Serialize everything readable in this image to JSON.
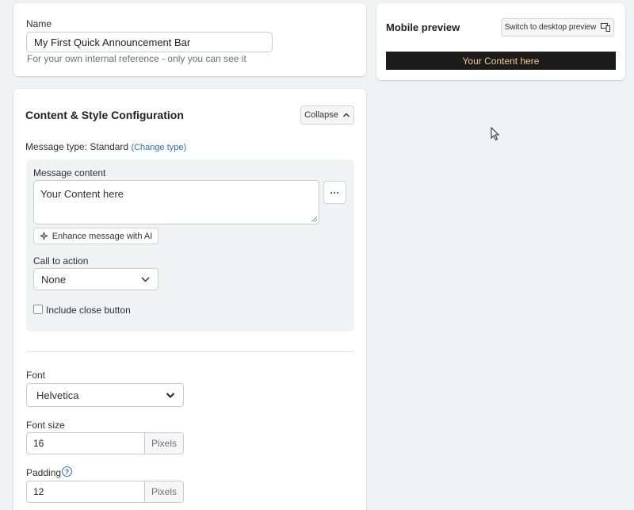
{
  "name_section": {
    "label": "Name",
    "value": "My First Quick Announcement Bar",
    "help": "For your own internal reference - only you can see it"
  },
  "config": {
    "title": "Content & Style Configuration",
    "collapse_label": "Collapse",
    "message_type_label": "Message type",
    "message_type_value": ": Standard",
    "change_type_link": "(Change type)",
    "message_content_label": "Message content",
    "message_content_value": "Your Content here",
    "more_button": "···",
    "enhance_ai_label": "Enhance message with AI",
    "cta_label": "Call to action",
    "cta_value": "None",
    "close_button_label": "Include close button",
    "font_label": "Font",
    "font_value": "Helvetica",
    "font_size_label": "Font size",
    "font_size_value": "16",
    "font_size_unit": "Pixels",
    "padding_label": "Padding",
    "padding_help_icon": "?",
    "padding_value": "12",
    "padding_unit": "Pixels"
  },
  "preview": {
    "title": "Mobile preview",
    "switch_label": "Switch to desktop preview",
    "bar_text": "Your Content here",
    "bar_bg": "#1c1c1c",
    "bar_text_color": "#f3c98f"
  }
}
